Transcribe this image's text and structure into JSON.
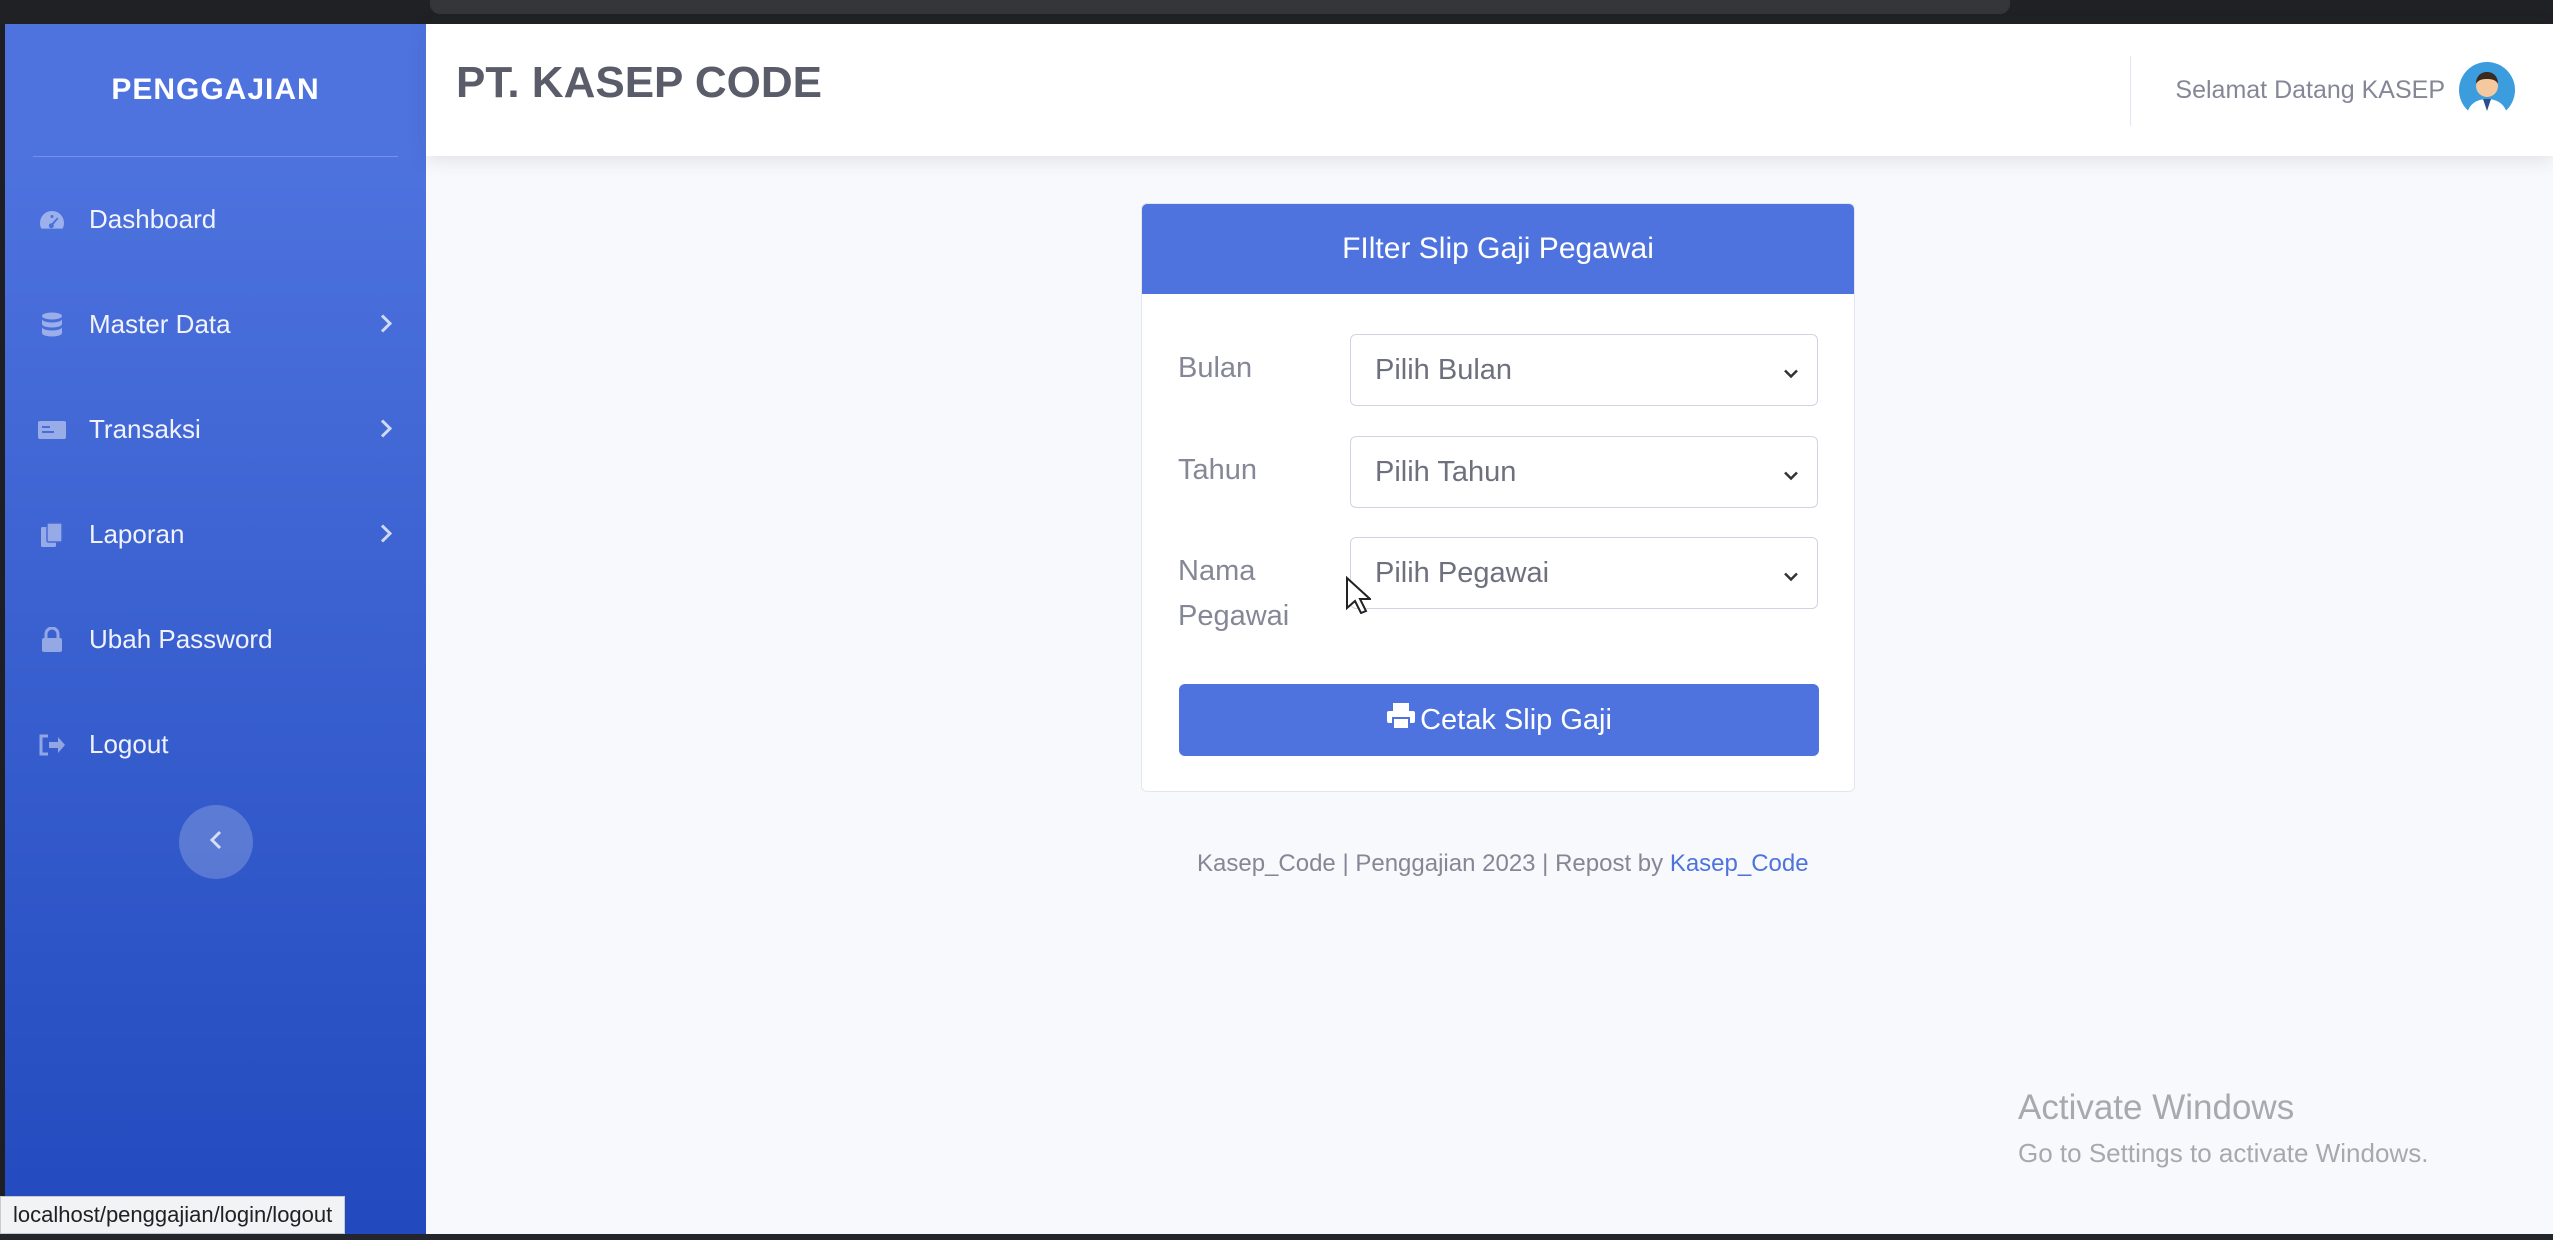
{
  "app": {
    "brand": "PENGGAJIAN",
    "company_title": "PT. KASEP CODE",
    "welcome_text": "Selamat Datang KASEP"
  },
  "sidebar": {
    "items": [
      {
        "label": "Dashboard",
        "icon": "tachometer-icon",
        "has_submenu": false
      },
      {
        "label": "Master Data",
        "icon": "database-icon",
        "has_submenu": true
      },
      {
        "label": "Transaksi",
        "icon": "money-bill-icon",
        "has_submenu": true
      },
      {
        "label": "Laporan",
        "icon": "copy-icon",
        "has_submenu": true
      },
      {
        "label": "Ubah Password",
        "icon": "lock-icon",
        "has_submenu": false
      },
      {
        "label": "Logout",
        "icon": "sign-out-icon",
        "has_submenu": false
      }
    ]
  },
  "filter_card": {
    "title": "FIlter Slip Gaji Pegawai",
    "fields": [
      {
        "label": "Bulan",
        "selected": "Pilih Bulan"
      },
      {
        "label": "Tahun",
        "selected": "Pilih Tahun"
      },
      {
        "label_line1": "Nama",
        "label_line2": "Pegawai",
        "selected": "Pilih Pegawai"
      }
    ],
    "print_button": "Cetak Slip Gaji"
  },
  "footer": {
    "text": "Kasep_Code | Penggajian 2023 | Repost by ",
    "link": "Kasep_Code"
  },
  "watermark": {
    "line1": "Activate Windows",
    "line2": "Go to Settings to activate Windows."
  },
  "status_bar": {
    "url": "localhost/penggajian/login/logout"
  },
  "colors": {
    "primary": "#4e73df",
    "sidebar_bottom": "#224abe",
    "text_muted": "#858796"
  }
}
